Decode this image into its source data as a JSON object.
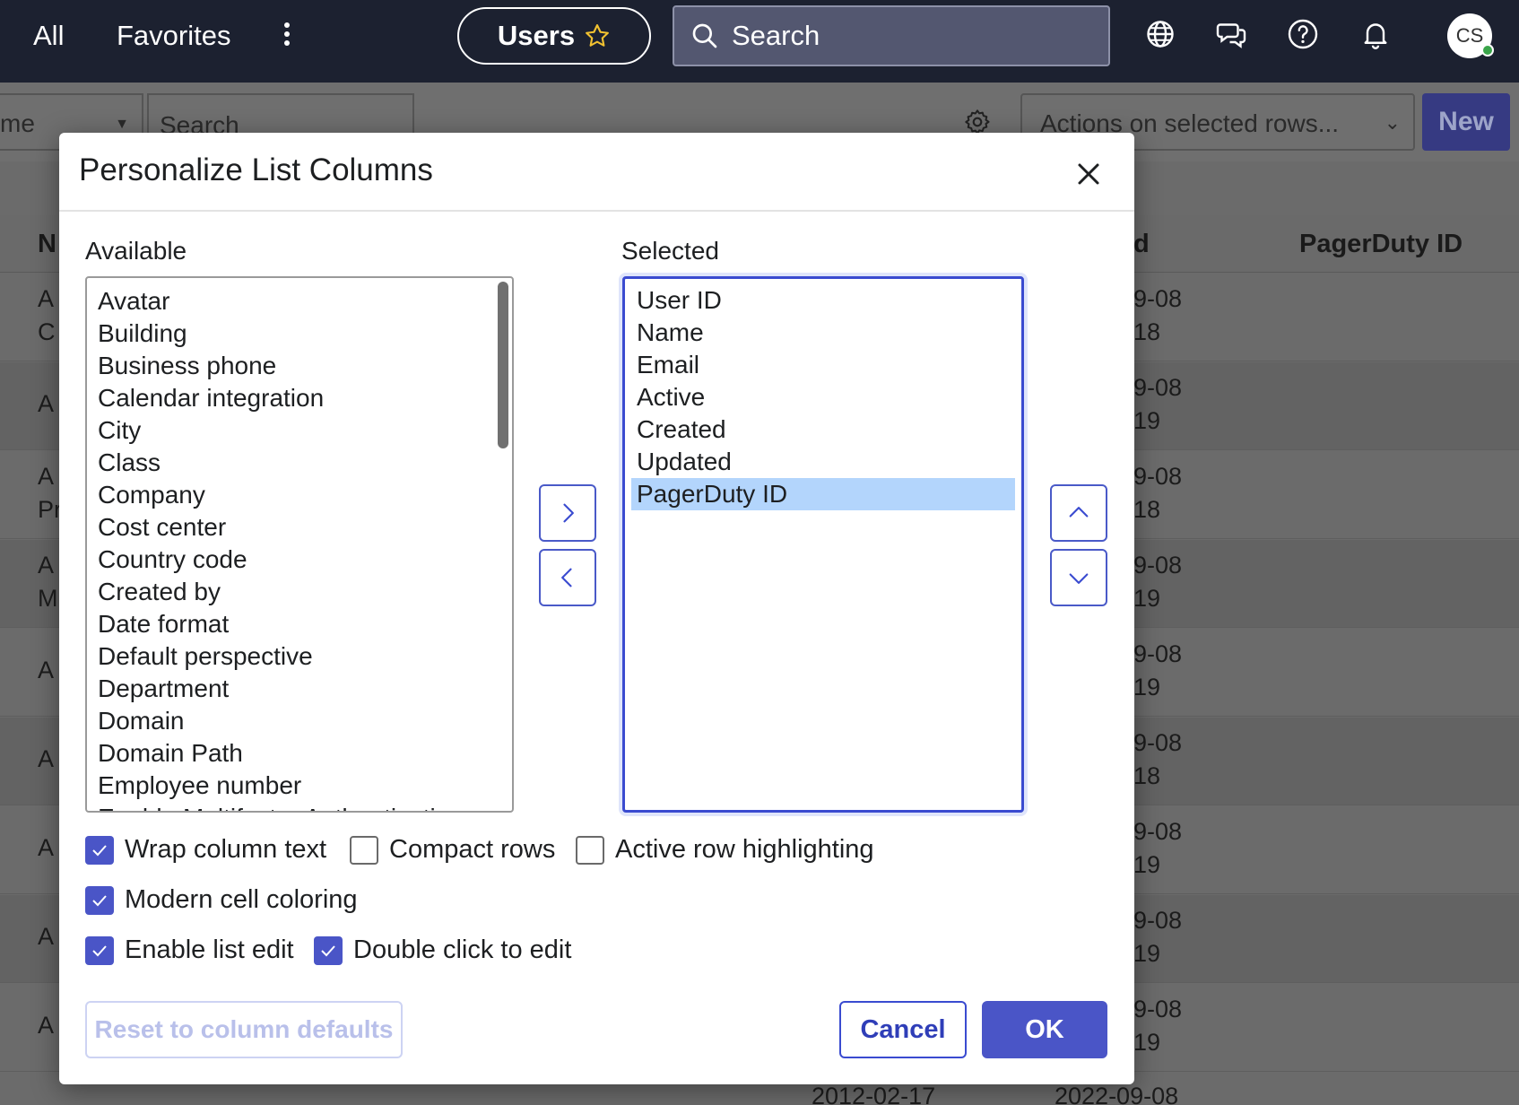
{
  "topnav": {
    "all_label": "All",
    "favorites_label": "Favorites",
    "users_pill_label": "Users",
    "search_placeholder": "Search",
    "avatar_initials": "CS"
  },
  "background": {
    "filter_select_value": "me",
    "search_placeholder": "Search",
    "actions_select_value": "Actions on selected rows...",
    "new_button_label": "New",
    "col_head_name_partial": "N",
    "col_head_updated_partial": "d",
    "col_head_pagerduty": "PagerDuty ID",
    "rows": [
      {
        "name_l1": "A",
        "name_l2": "C",
        "upd_l1": "9-08",
        "upd_l2": "18"
      },
      {
        "name_l1": "A",
        "name_l2": "",
        "upd_l1": "9-08",
        "upd_l2": "19"
      },
      {
        "name_l1": "A",
        "name_l2": "Pr",
        "upd_l1": "9-08",
        "upd_l2": "18"
      },
      {
        "name_l1": "A",
        "name_l2": "M",
        "upd_l1": "9-08",
        "upd_l2": "19"
      },
      {
        "name_l1": "A",
        "name_l2": "",
        "upd_l1": "9-08",
        "upd_l2": "19"
      },
      {
        "name_l1": "A",
        "name_l2": "",
        "upd_l1": "9-08",
        "upd_l2": "18"
      },
      {
        "name_l1": "A",
        "name_l2": "",
        "upd_l1": "9-08",
        "upd_l2": "19"
      },
      {
        "name_l1": "A",
        "name_l2": "",
        "upd_l1": "9-08",
        "upd_l2": "19"
      },
      {
        "name_l1": "A",
        "name_l2": "",
        "upd_l1": "9-08",
        "upd_l2": "19"
      }
    ],
    "last_row_created": "2012-02-17",
    "last_row_updated": "2022-09-08"
  },
  "modal": {
    "title": "Personalize List Columns",
    "available_label": "Available",
    "selected_label": "Selected",
    "available_items": [
      "Avatar",
      "Building",
      "Business phone",
      "Calendar integration",
      "City",
      "Class",
      "Company",
      "Cost center",
      "Country code",
      "Created by",
      "Date format",
      "Default perspective",
      "Department",
      "Domain",
      "Domain Path",
      "Employee number",
      "Enable Multifactor Authentication"
    ],
    "selected_items": [
      "User ID",
      "Name",
      "Email",
      "Active",
      "Created",
      "Updated",
      "PagerDuty ID"
    ],
    "options": {
      "wrap_column_text": "Wrap column text",
      "compact_rows": "Compact rows",
      "active_row_highlighting": "Active row highlighting",
      "modern_cell_coloring": "Modern cell coloring",
      "enable_list_edit": "Enable list edit",
      "double_click_to_edit": "Double click to edit"
    },
    "reset_label": "Reset to column defaults",
    "cancel_label": "Cancel",
    "ok_label": "OK"
  },
  "colors": {
    "nav_bg": "#1c2130",
    "accent": "#4a55c7",
    "selection": "#b3d5fc"
  }
}
